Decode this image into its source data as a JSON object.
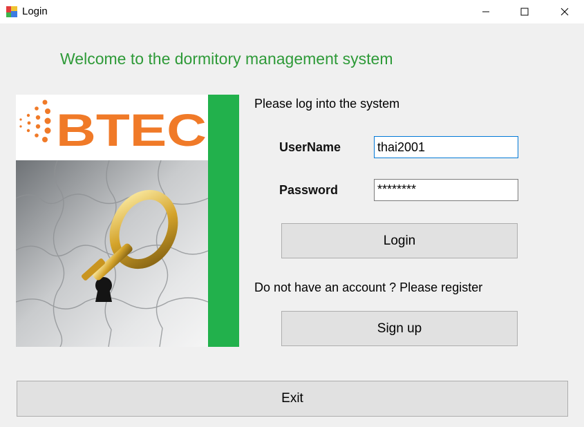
{
  "window": {
    "title": "Login",
    "icon": "app-window-icon",
    "controls": [
      "minimize-icon",
      "maximize-icon",
      "close-icon"
    ]
  },
  "welcome_text": "Welcome to the dormitory management system",
  "image": {
    "brand_text": "BTEC"
  },
  "colors": {
    "welcome": "#2e9a38",
    "green_bar": "#22b14c",
    "brand_orange": "#f07a28"
  },
  "prompt_text": "Please log into the system",
  "username": {
    "label": "UserName",
    "value": "thai2001"
  },
  "password": {
    "label": "Password",
    "value": "********"
  },
  "buttons": {
    "login": "Login",
    "signup": "Sign up",
    "exit": "Exit"
  },
  "register_text": "Do not have an account ? Please register"
}
